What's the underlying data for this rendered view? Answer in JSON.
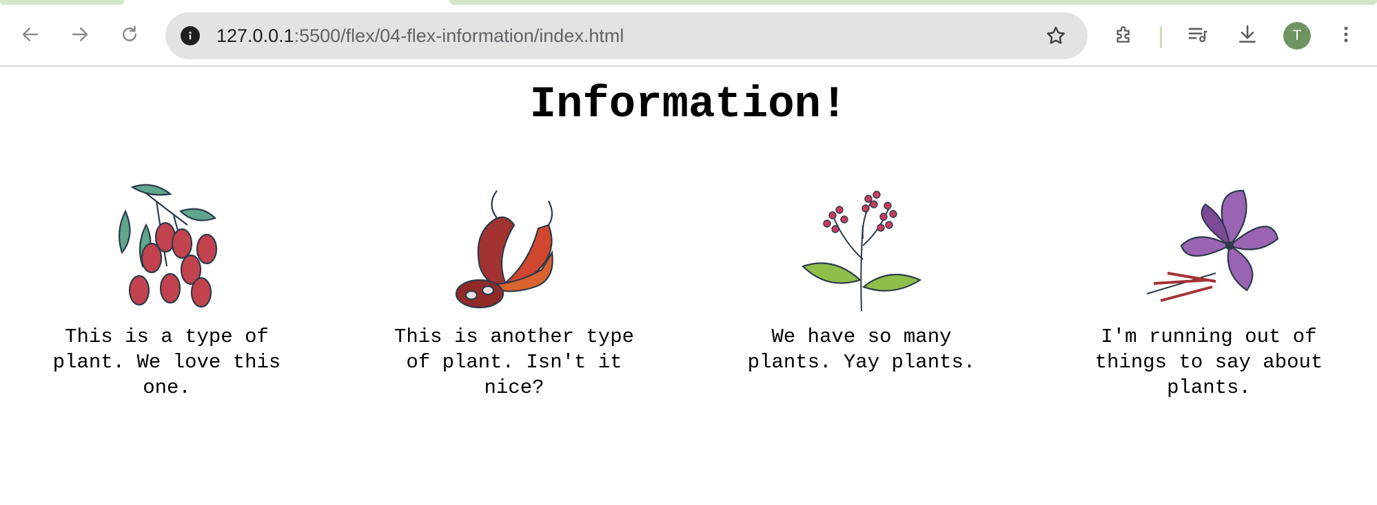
{
  "browser": {
    "url_host": "127.0.0.1",
    "url_path": ":5500/flex/04-flex-information/index.html",
    "profile_initial": "T",
    "icons": [
      "back-arrow-icon",
      "forward-arrow-icon",
      "reload-icon",
      "site-info-icon",
      "bookmark-star-icon",
      "extensions-icon",
      "media-queue-icon",
      "download-icon",
      "kebab-menu-icon"
    ],
    "accent_color": "#d2e8c9"
  },
  "page": {
    "title": "Information!",
    "cards": [
      {
        "image": "goji-berries-icon",
        "text": "This is a type of plant. We love this one."
      },
      {
        "image": "chili-peppers-icon",
        "text": "This is another type of plant. Isn't it nice?"
      },
      {
        "image": "flowering-plant-icon",
        "text": "We have so many plants. Yay plants."
      },
      {
        "image": "saffron-flower-icon",
        "text": "I'm running out of things to say about plants."
      }
    ]
  }
}
